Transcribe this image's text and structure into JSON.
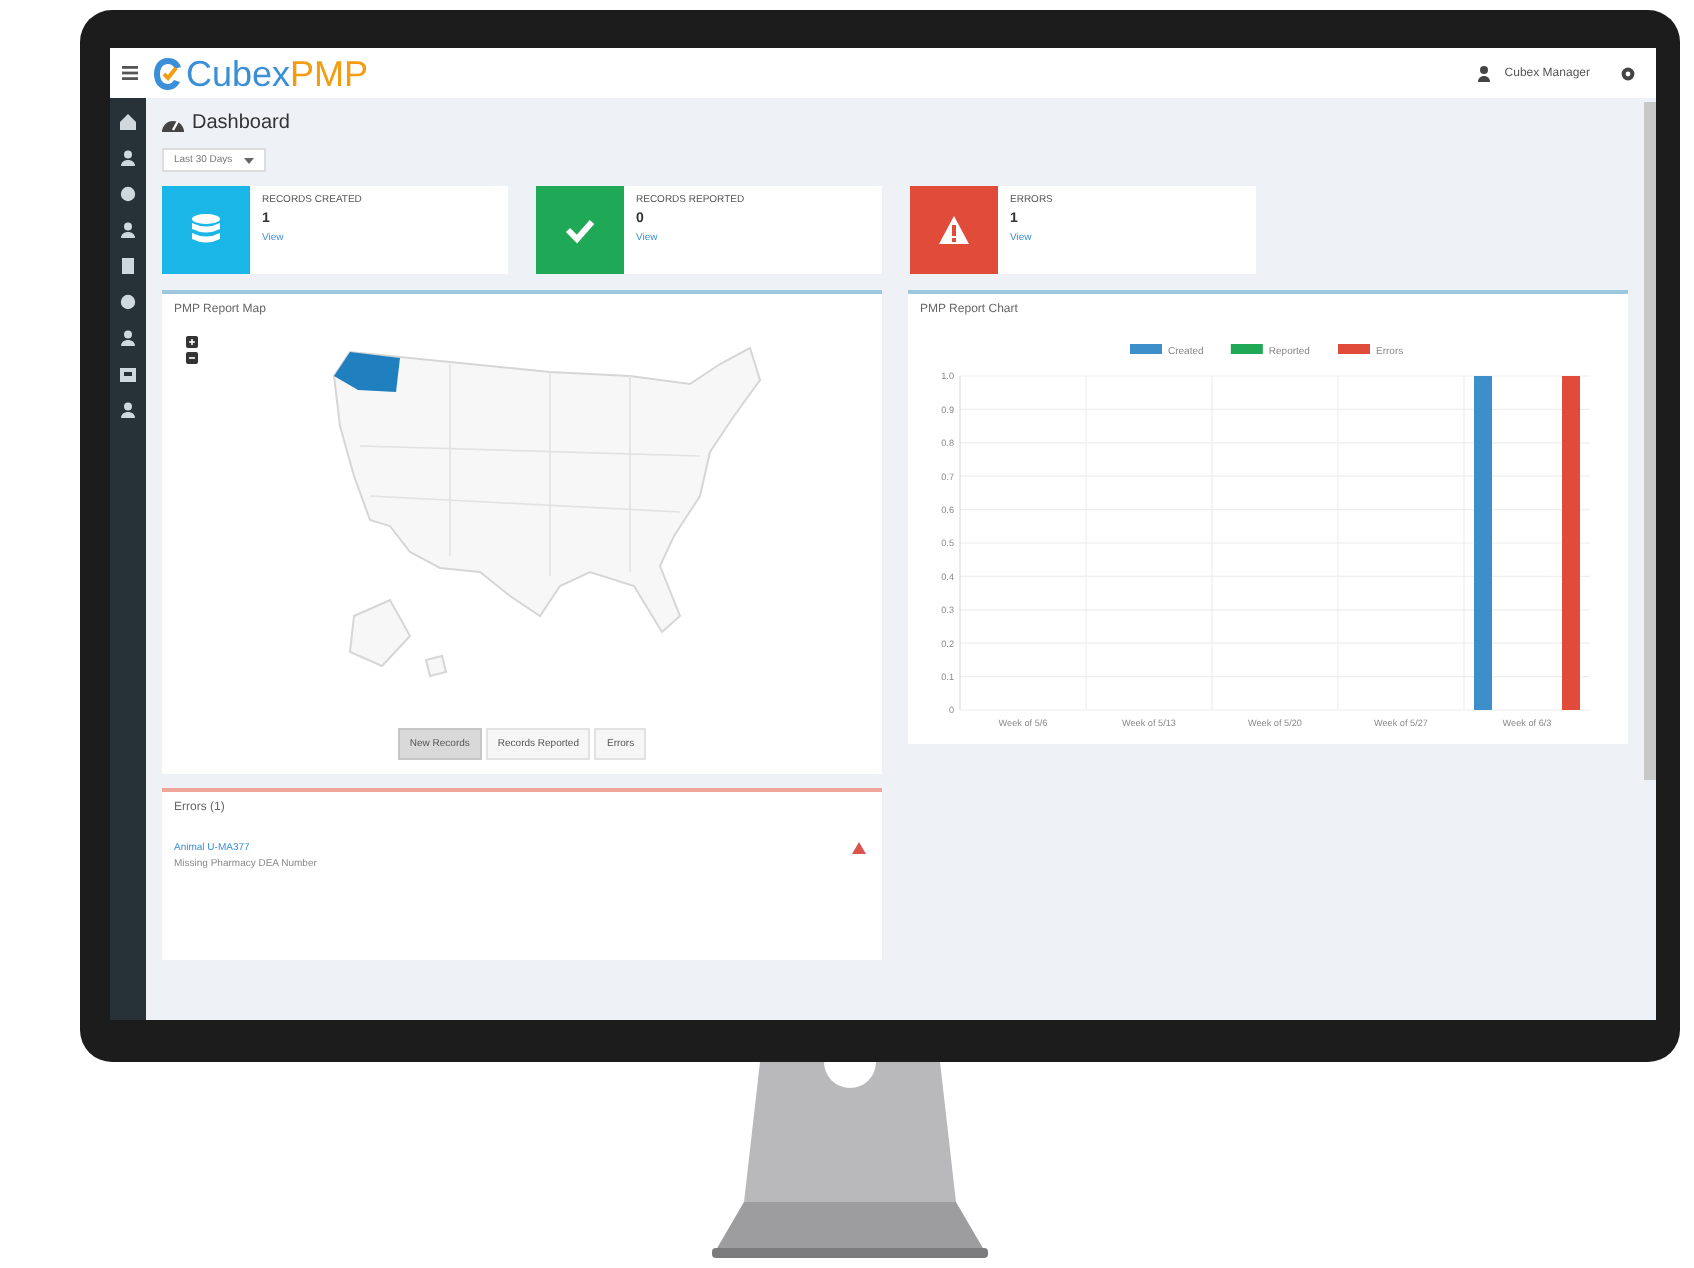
{
  "topbar": {
    "logo_prefix": "Cubex",
    "logo_suffix": "PMP",
    "user": "Cubex Manager"
  },
  "page": {
    "title": "Dashboard",
    "period_select": {
      "value": "Last 30 Days"
    }
  },
  "cards": [
    {
      "label": "RECORDS CREATED",
      "count": "1",
      "link": "View",
      "color": "#1bb6e8"
    },
    {
      "label": "RECORDS REPORTED",
      "count": "0",
      "link": "View",
      "color": "#1fa855"
    },
    {
      "label": "ERRORS",
      "count": "1",
      "link": "View",
      "color": "#e04b3a"
    }
  ],
  "map_panel": {
    "title": "PMP Report Map",
    "buttons": [
      {
        "label": "New Records",
        "selected": true
      },
      {
        "label": "Records Reported",
        "selected": false
      },
      {
        "label": "Errors",
        "selected": false
      }
    ]
  },
  "chart_panel": {
    "title": "PMP Report Chart",
    "chart_data": {
      "type": "bar",
      "categories": [
        "Week of 5/6",
        "Week of 5/13",
        "Week of 5/20",
        "Week of 5/27",
        "Week of 6/3"
      ],
      "series": [
        {
          "name": "Created",
          "color": "#3d8fc9",
          "values": [
            0,
            0,
            0,
            0,
            1
          ]
        },
        {
          "name": "Reported",
          "color": "#1fa855",
          "values": [
            0,
            0,
            0,
            0,
            0
          ]
        },
        {
          "name": "Errors",
          "color": "#e04b3a",
          "values": [
            0,
            0,
            0,
            0,
            1
          ]
        }
      ],
      "grid": true,
      "legend": true,
      "ylim": [
        0,
        1
      ],
      "yticks": [
        {
          "value": 0,
          "label": "0"
        },
        0.1,
        0.2,
        0.3,
        0.4,
        0.5,
        0.6,
        0.7,
        0.8,
        0.9,
        {
          "value": 1,
          "label": "1.0"
        }
      ]
    }
  },
  "errors_panel": {
    "title": "Errors (1)",
    "items": [
      {
        "link": "Animal U-MA377",
        "message": "Missing Pharmacy DEA Number"
      }
    ]
  }
}
